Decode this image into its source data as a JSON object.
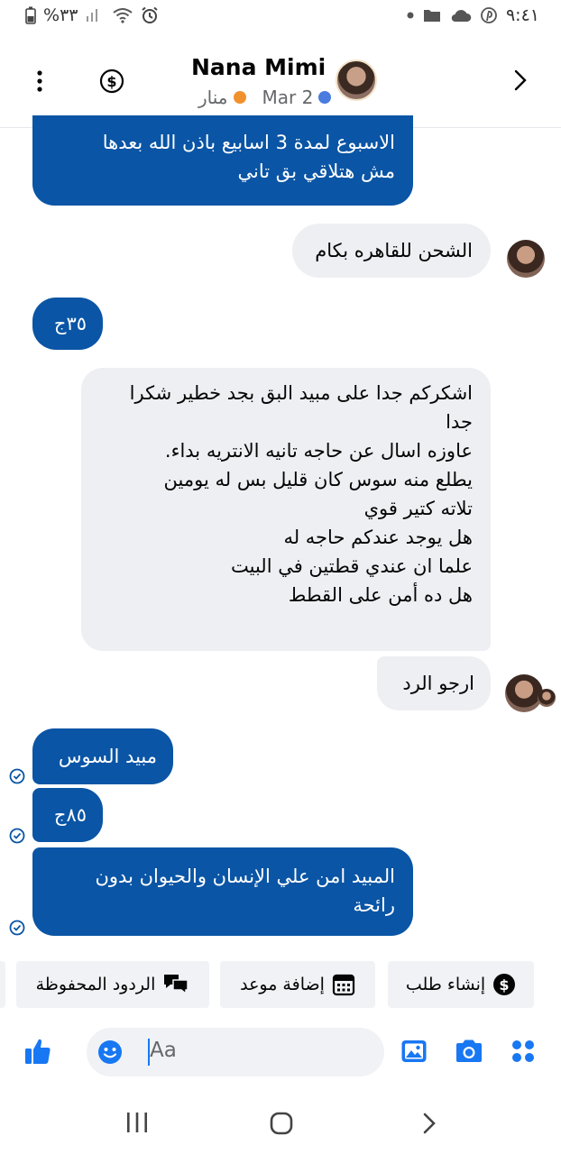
{
  "status_bar": {
    "time": "٩:٤١",
    "battery": "%٣٣"
  },
  "header": {
    "contact_name": "Nana Mimi",
    "date_label": "Mar 2",
    "tag_label": "منار",
    "tag_colors": {
      "blue": "#4a7bdf",
      "orange": "#f0912d"
    }
  },
  "messages": [
    {
      "dir": "out",
      "text": "الاسبوع لمدة 3 اسابيع باذن الله بعدها\nمش هتلاقي بق تاني"
    },
    {
      "dir": "in",
      "text": "الشحن للقاهره بكام"
    },
    {
      "dir": "out",
      "text": "٣٥ج"
    },
    {
      "dir": "in",
      "text": "اشكركم جدا على مبيد البق بجد خطير شكرا\nجدا\nعاوزه اسال عن حاجه تانيه الانتريه بداء.\nيطلع منه سوس  كان قليل بس له يومين\nتلاته كتير قوي\nهل يوجد عندكم حاجه له\nعلما ان عندي قطتين في البيت\nهل ده أمن على القطط"
    },
    {
      "dir": "in",
      "text": "ارجو الرد"
    },
    {
      "dir": "out",
      "text": "مبيد السوس"
    },
    {
      "dir": "out",
      "text": "٨٥ج"
    },
    {
      "dir": "out",
      "text": "المبيد امن علي الإنسان والحيوان بدون\nرائحة"
    }
  ],
  "quick_replies": {
    "create_order": "إنشاء طلب",
    "add_appointment": "إضافة موعد",
    "saved_replies": "الردود المحفوظة"
  },
  "composer": {
    "placeholder": "Aa"
  },
  "colors": {
    "brand_blue": "#0a55a5",
    "icon_blue": "#1877f2",
    "bubble_gray": "#eeeff2"
  }
}
